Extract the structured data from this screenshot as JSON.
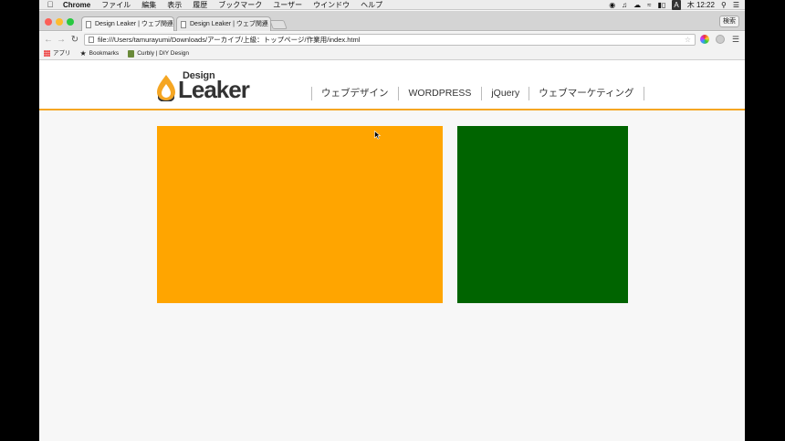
{
  "menubar": {
    "app": "Chrome",
    "items": [
      "ファイル",
      "編集",
      "表示",
      "履歴",
      "ブックマーク",
      "ユーザー",
      "ウインドウ",
      "ヘルプ"
    ],
    "clock": "木 12:22"
  },
  "tabs": [
    {
      "label": "Design Leaker | ウェブ関連",
      "active": true
    },
    {
      "label": "Design Leaker | ウェブ関連",
      "active": false
    }
  ],
  "window": {
    "search_button": "検索"
  },
  "toolbar": {
    "url": "file:///Users/tamurayumi/Downloads/アーカイブ/上級：トップページ/作業用/index.html"
  },
  "bookmarks": [
    {
      "label": "アプリ",
      "icon": "apps-grid-icon"
    },
    {
      "label": "Bookmarks",
      "icon": "star-icon"
    },
    {
      "label": "Curbly | DIY Design",
      "icon": "curbly-icon"
    }
  ],
  "site": {
    "logo_top": "Design",
    "logo_main": "Leaker",
    "nav": [
      "ウェブデザイン",
      "WORDPRESS",
      "jQuery",
      "ウェブマーケティング"
    ]
  },
  "colors": {
    "accent": "#f5a623",
    "main_box": "#ffa500",
    "side_box": "#006400"
  }
}
